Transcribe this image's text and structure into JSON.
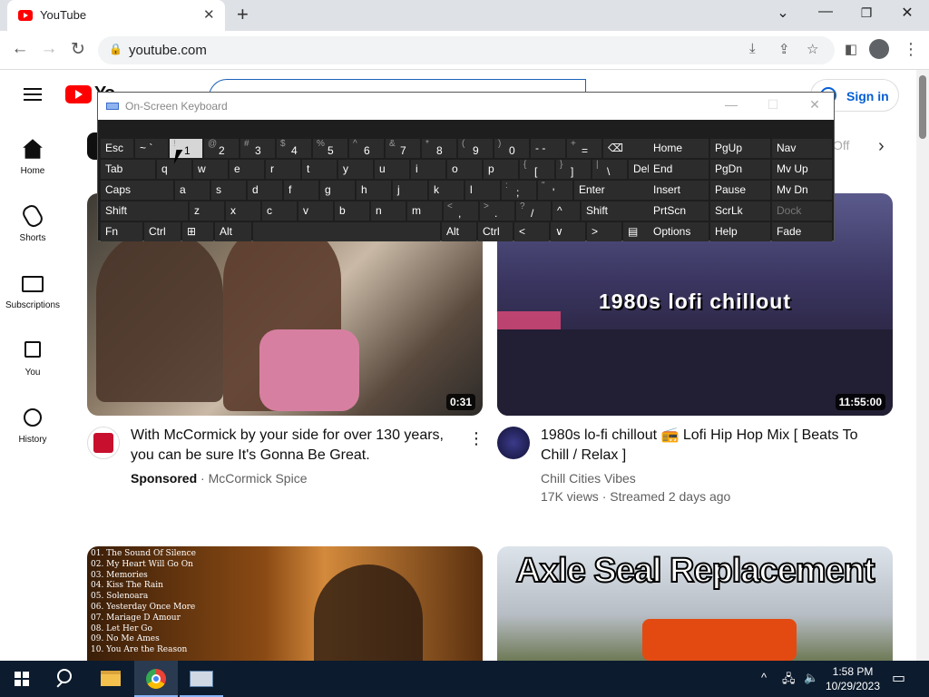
{
  "browser": {
    "tab_title": "YouTube",
    "url": "youtube.com",
    "colors": {
      "tab_strip": "#dee1e6",
      "omnibox": "#f1f3f4"
    }
  },
  "youtube": {
    "logo_text": "YouTube",
    "sign_in": "Sign in",
    "chip_partial": "Off",
    "sidebar": [
      {
        "label": "Home",
        "icon": "home-icon"
      },
      {
        "label": "Shorts",
        "icon": "shorts-icon"
      },
      {
        "label": "Subscriptions",
        "icon": "subscriptions-icon"
      },
      {
        "label": "You",
        "icon": "you-icon"
      },
      {
        "label": "History",
        "icon": "history-icon"
      }
    ],
    "videos": [
      {
        "title": "With McCormick by your side for over 130 years, you can be sure It's Gonna Be Great.",
        "duration": "0:31",
        "sponsored": "Sponsored",
        "channel": "McCormick Spice",
        "views": ""
      },
      {
        "title": "1980s lo-fi chillout 📻 Lofi Hip Hop Mix [ Beats To Chill / Relax ]",
        "thumb_text": "1980s lofi chillout",
        "duration": "11:55:00",
        "channel": "Chill Cities Vibes",
        "views": "17K views · Streamed 2 days ago"
      }
    ],
    "partial_thumbs": [
      {
        "lines": [
          "01. The Sound Of Silence",
          "02. My Heart Will Go On",
          "03. Memories",
          "04. Kiss The Rain",
          "05. Solenoara",
          "06. Yesterday Once More",
          "07. Mariage D Amour",
          "08. Let Her Go",
          "09. No Me Ames",
          "10. You Are the Reason"
        ]
      },
      {
        "title": "Axle Seal Replacement"
      }
    ]
  },
  "osk": {
    "title": "On-Screen Keyboard",
    "rows": [
      [
        {
          "l": "Esc"
        },
        {
          "l": "~ `"
        },
        {
          "l": "1",
          "s": "!"
        },
        {
          "l": "2",
          "s": "@"
        },
        {
          "l": "3",
          "s": "#"
        },
        {
          "l": "4",
          "s": "$"
        },
        {
          "l": "5",
          "s": "%"
        },
        {
          "l": "6",
          "s": "^"
        },
        {
          "l": "7",
          "s": "&"
        },
        {
          "l": "8",
          "s": "*"
        },
        {
          "l": "9",
          "s": "("
        },
        {
          "l": "0",
          "s": ")"
        },
        {
          "l": "- -"
        },
        {
          "l": "=",
          "s": "+"
        },
        {
          "l": "⌫"
        }
      ],
      [
        {
          "l": "Tab"
        },
        {
          "l": "q"
        },
        {
          "l": "w"
        },
        {
          "l": "e"
        },
        {
          "l": "r"
        },
        {
          "l": "t"
        },
        {
          "l": "y"
        },
        {
          "l": "u"
        },
        {
          "l": "i"
        },
        {
          "l": "o"
        },
        {
          "l": "p"
        },
        {
          "l": "[",
          "s": "{"
        },
        {
          "l": "]",
          "s": "}"
        },
        {
          "l": "\\",
          "s": "|"
        },
        {
          "l": "Del"
        }
      ],
      [
        {
          "l": "Caps"
        },
        {
          "l": "a"
        },
        {
          "l": "s"
        },
        {
          "l": "d"
        },
        {
          "l": "f"
        },
        {
          "l": "g"
        },
        {
          "l": "h"
        },
        {
          "l": "j"
        },
        {
          "l": "k"
        },
        {
          "l": "l"
        },
        {
          "l": ";",
          "s": ":"
        },
        {
          "l": "'",
          "s": "\""
        },
        {
          "l": "Enter"
        }
      ],
      [
        {
          "l": "Shift"
        },
        {
          "l": "z"
        },
        {
          "l": "x"
        },
        {
          "l": "c"
        },
        {
          "l": "v"
        },
        {
          "l": "b"
        },
        {
          "l": "n"
        },
        {
          "l": "m"
        },
        {
          "l": ",",
          "s": "<"
        },
        {
          "l": ".",
          "s": ">"
        },
        {
          "l": "/",
          "s": "?"
        },
        {
          "l": "^"
        },
        {
          "l": "Shift"
        }
      ],
      [
        {
          "l": "Fn"
        },
        {
          "l": "Ctrl"
        },
        {
          "l": "⊞"
        },
        {
          "l": "Alt"
        },
        {
          "l": ""
        },
        {
          "l": "Alt"
        },
        {
          "l": "Ctrl"
        },
        {
          "l": "<"
        },
        {
          "l": "∨"
        },
        {
          "l": ">"
        },
        {
          "l": "▤"
        }
      ]
    ],
    "nav": [
      [
        "Home",
        "PgUp",
        "Nav"
      ],
      [
        "End",
        "PgDn",
        "Mv Up"
      ],
      [
        "Insert",
        "Pause",
        "Mv Dn"
      ],
      [
        "PrtScn",
        "ScrLk",
        "Dock"
      ],
      [
        "Options",
        "Help",
        "Fade"
      ]
    ],
    "active_key": "1"
  },
  "taskbar": {
    "time": "1:58 PM",
    "date": "10/29/2023"
  }
}
